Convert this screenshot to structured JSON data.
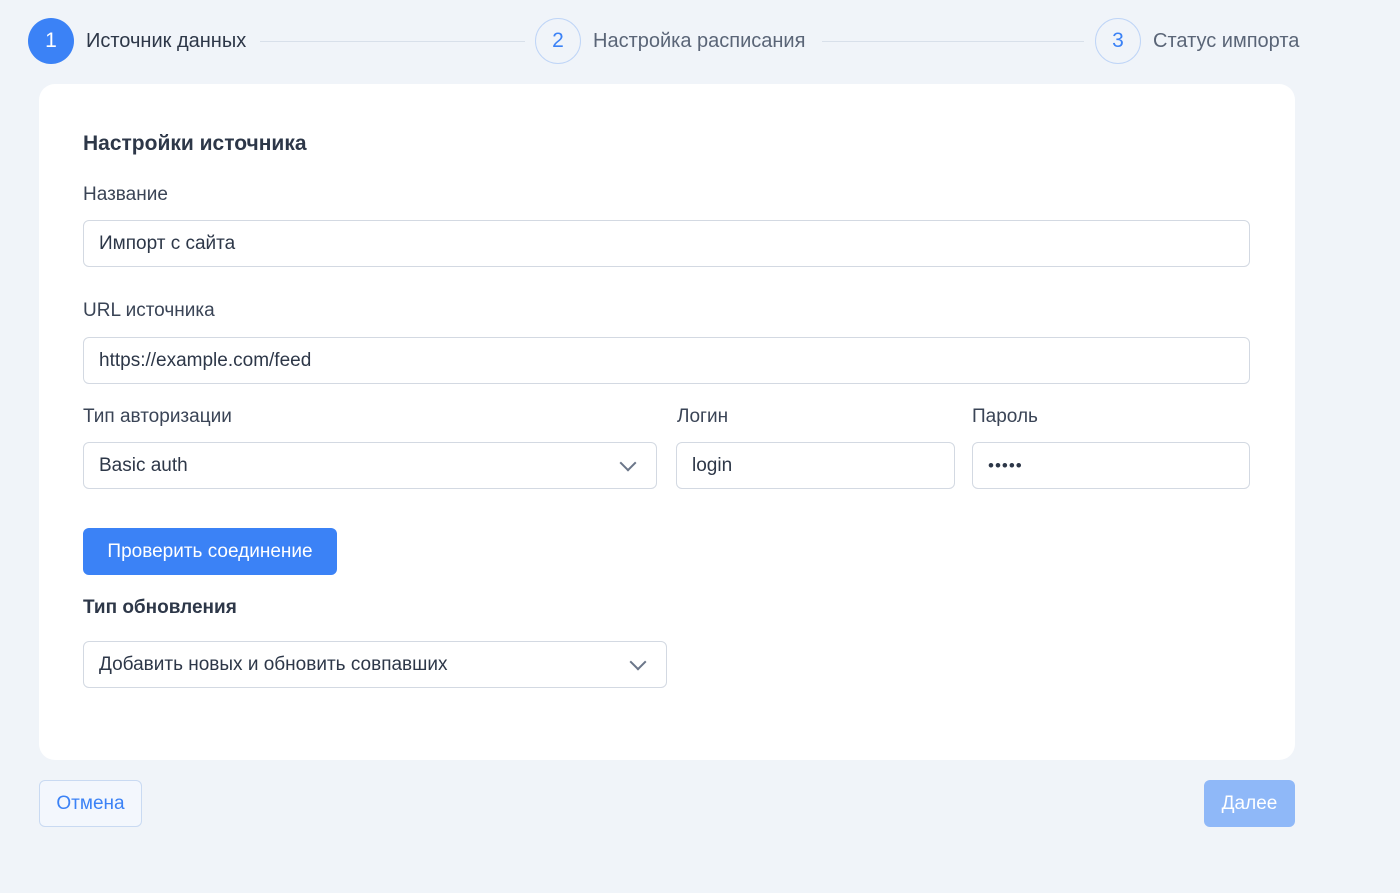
{
  "stepper": {
    "steps": [
      {
        "number": "1",
        "label": "Источник данных",
        "state": "active"
      },
      {
        "number": "2",
        "label": "Настройка расписания",
        "state": "inactive"
      },
      {
        "number": "3",
        "label": "Статус импорта",
        "state": "inactive"
      }
    ]
  },
  "form": {
    "title": "Настройки источника",
    "name": {
      "label": "Название",
      "value": "Импорт с сайта"
    },
    "url": {
      "label": "URL источника",
      "value": "https://example.com/feed"
    },
    "auth_type": {
      "label": "Тип авторизации",
      "value": "Basic auth"
    },
    "login": {
      "label": "Логин",
      "value": "login"
    },
    "password": {
      "label": "Пароль",
      "value": "•••••"
    },
    "check_button": "Проверить соединение",
    "update_type": {
      "label": "Тип обновления",
      "value": "Добавить новых и обновить совпавших"
    }
  },
  "footer": {
    "cancel_label": "Отмена",
    "next_label": "Далее"
  },
  "colors": {
    "accent": "#3b82f6",
    "accent_disabled": "#8fb8f8",
    "background": "#f0f4f9"
  },
  "icons": {
    "select_chevron": "chevron-down-icon"
  }
}
